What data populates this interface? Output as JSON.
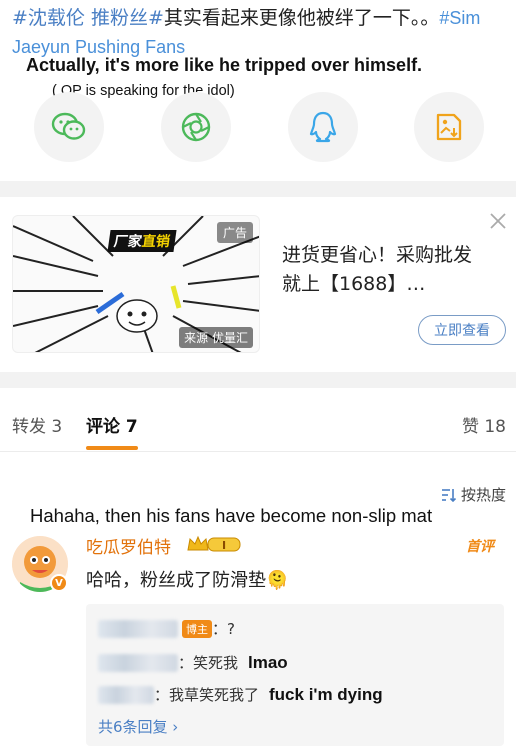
{
  "post": {
    "tag1": "#沈载伦 推粉丝#",
    "text": "其实看起来更像他被绊了一下。。",
    "tag_en": "#Sim Jaeyun Pushing Fans"
  },
  "translation_overlay": {
    "line1": "Actually, it's more like he tripped over himself.",
    "line2": "( OP is speaking for the idol)"
  },
  "share": {
    "wechat_icon": "wechat-icon",
    "moments_icon": "wechat-moments-icon",
    "qq_icon": "qq-icon",
    "save_image_icon": "save-image-icon"
  },
  "ad": {
    "badge": "广告",
    "brand_prefix": "厂家",
    "brand_highlight": "直销",
    "source_label": "来源 优量汇",
    "title": "进货更省心！采购批发就上【1688】…",
    "cta": "立即查看"
  },
  "tabs": {
    "repost": "转发 3",
    "comments": "评论 7",
    "likes": "赞 18"
  },
  "sort": {
    "label": "按热度"
  },
  "comment_translation": "Hahaha, then his fans have become non-slip mat",
  "comment": {
    "username": "吃瓜罗伯特",
    "level": "I",
    "first_tag": "首评",
    "verified": "V",
    "text": "哈哈，粉丝成了防滑垫🫠"
  },
  "replies": [
    {
      "host_tag": "博主",
      "text": "：?",
      "translation": ""
    },
    {
      "host_tag": "",
      "text": "：笑死我",
      "translation": "lmao"
    },
    {
      "host_tag": "",
      "text": "：我草笑死我了",
      "translation": "fuck i'm dying"
    }
  ],
  "more_replies": "共6条回复 ›",
  "colors": {
    "accent_orange": "#f08a17",
    "link_blue": "#4a7fc4",
    "username_orange": "#e2720b"
  }
}
